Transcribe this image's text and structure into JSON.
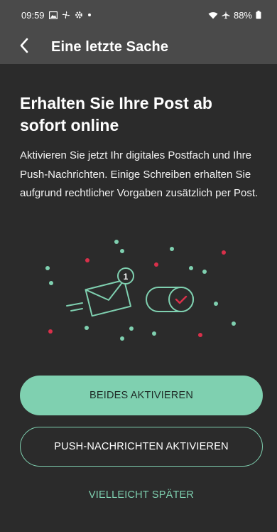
{
  "status_bar": {
    "time": "09:59",
    "battery": "88%",
    "icons": [
      "gallery-icon",
      "fan-icon",
      "settings-icon",
      "dot-icon",
      "wifi-icon",
      "airplane-icon",
      "battery-icon"
    ]
  },
  "app_bar": {
    "title": "Eine letzte Sache",
    "back_icon": "chevron-left-icon"
  },
  "main": {
    "heading": "Erhalten Sie Ihre Post ab sofort online",
    "body": "Aktivieren Sie jetzt Ihr digitales Postfach und Ihre Push-Nachrichten. Einige Schreiben erhalten Sie aufgrund rechtlicher Vorgaben zusätzlich per Post."
  },
  "illustration": {
    "icons": [
      "envelope-icon",
      "notification-badge-icon",
      "toggle-switch-icon",
      "checkmark-icon"
    ],
    "badge_count": "1"
  },
  "actions": {
    "primary_label": "BEIDES AKTIVIEREN",
    "secondary_label": "PUSH-NACHRICHTEN AKTIVIEREN",
    "tertiary_label": "VIELLEICHT SPÄTER"
  },
  "colors": {
    "accent": "#7fd0b0",
    "accent_red": "#d9304a",
    "background": "#2b2b2b",
    "app_bar": "#4a4a4a"
  }
}
